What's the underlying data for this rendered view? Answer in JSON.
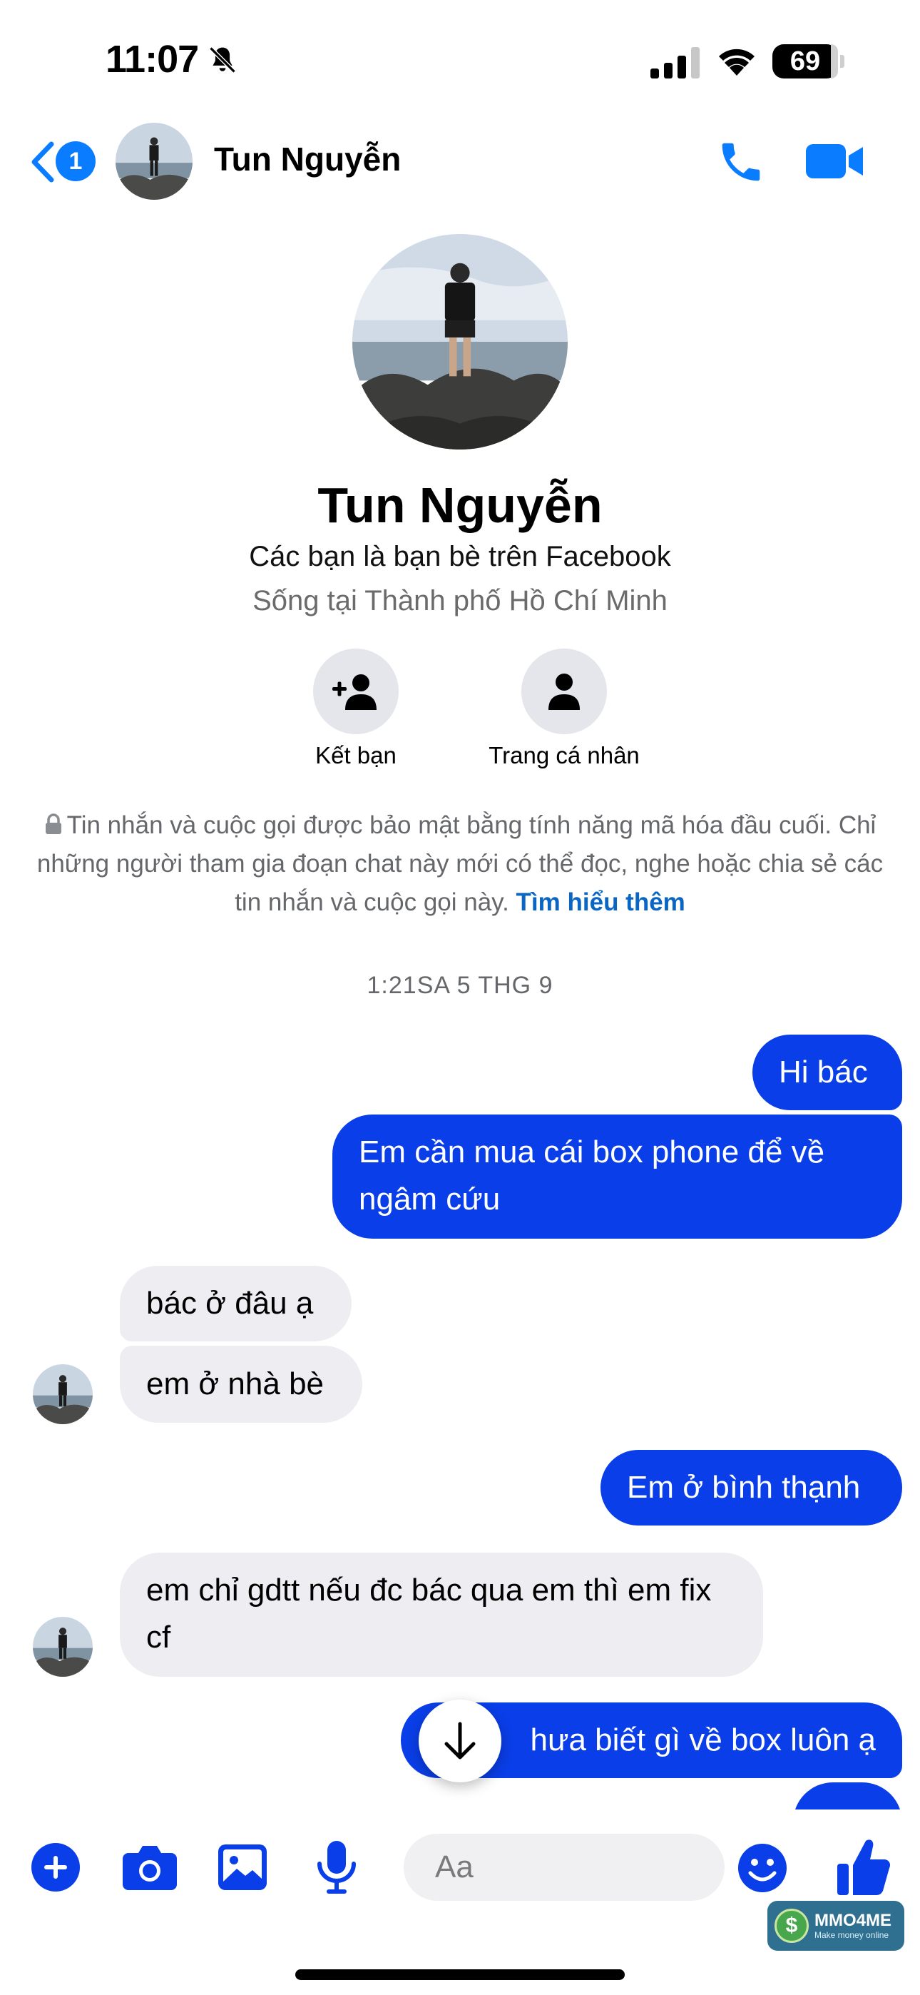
{
  "status_bar": {
    "time": "11:07",
    "battery": "69"
  },
  "header": {
    "unread_count": "1",
    "contact_name": "Tun Nguyễn"
  },
  "profile": {
    "name": "Tun Nguyễn",
    "relation": "Các bạn là bạn bè trên Facebook",
    "location": "Sống tại Thành phố Hồ Chí Minh",
    "add_friend_label": "Kết bạn",
    "profile_label": "Trang cá nhân"
  },
  "encryption_notice": {
    "text": "Tin nhắn và cuộc gọi được bảo mật bằng tính năng mã hóa đầu cuối. Chỉ những người tham gia đoạn chat này mới có thể đọc, nghe hoặc chia sẻ các tin nhắn và cuộc gọi này.",
    "link": "Tìm hiểu thêm"
  },
  "timestamp": "1:21SA 5 THG 9",
  "messages": [
    {
      "from": "me",
      "text": "Hi bác"
    },
    {
      "from": "me",
      "text": "Em cần mua cái box phone để về ngâm cứu"
    },
    {
      "from": "them",
      "text": "bác ở đâu ạ"
    },
    {
      "from": "them",
      "text": "em ở nhà bè"
    },
    {
      "from": "me",
      "text": "Em ở bình thạnh"
    },
    {
      "from": "them",
      "text": "em chỉ gdtt nếu đc bác qua em thì em fix cf"
    },
    {
      "from": "me",
      "text": "hưa biết gì về box luôn ạ"
    }
  ],
  "composer": {
    "placeholder": "Aa"
  },
  "watermark": {
    "title": "MMO4ME",
    "subtitle": "Make money online"
  },
  "colors": {
    "accent": "#0a7cff",
    "outgoing_bubble": "#0a3ee8",
    "incoming_bubble": "#eeeef2"
  }
}
